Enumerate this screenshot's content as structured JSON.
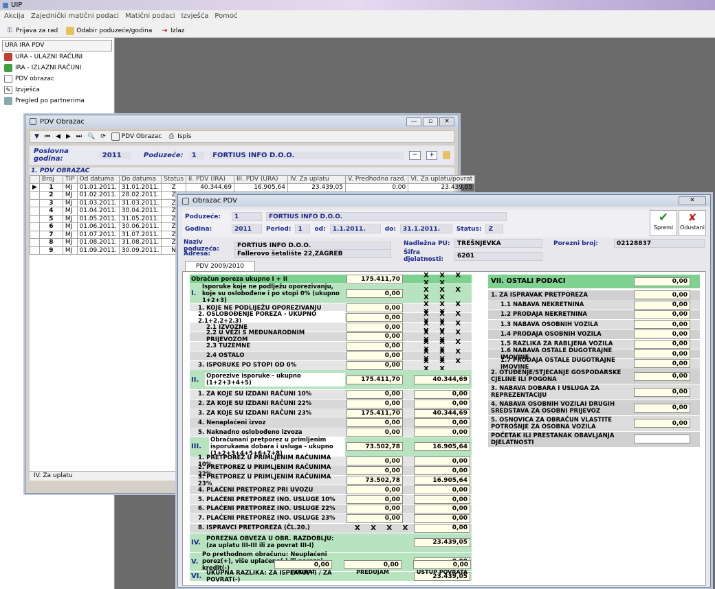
{
  "app": {
    "title": "UIP"
  },
  "menu": [
    "Akcija",
    "Zajednički matični podaci",
    "Matični podaci",
    "Izvješća",
    "Pomoć"
  ],
  "toolbar": {
    "login": "Prijava za rad",
    "select": "Odabir poduzeće/godina",
    "exit": "Izlaz"
  },
  "nav": {
    "header": "URA IRA PDV",
    "items": [
      "URA - ULAZNI RAČUNI",
      "IRA - IZLAZNI RAČUNI",
      "PDV obrazac",
      "Izvješća",
      "Pregled po partnerima"
    ]
  },
  "w1": {
    "title": "PDV Obrazac",
    "tb_pdv": "PDV Obrazac",
    "tb_print": "Ispis",
    "godina_lbl": "Poslovna godina:",
    "godina": "2011",
    "pod_lbl": "Poduzeće:",
    "pod_id": "1",
    "pod_name": "FORTIUS INFO D.O.O.",
    "grid_title": "1. PDV OBRAZAC",
    "cols": [
      "Broj",
      "TIP",
      "Od datuma",
      "Do datuma",
      "Status",
      "II. PDV (IRA)",
      "III. PDV (URA)",
      "IV. Za uplatu",
      "V. Predhodno razd.",
      "VI. Za uplatu/povrat"
    ],
    "rows": [
      [
        "1",
        "MJ",
        "01.01.2011.",
        "31.01.2011.",
        "Z",
        "40.344,69",
        "16.905,64",
        "23.439,05",
        "0,00",
        "23.439,05"
      ],
      [
        "2",
        "MJ",
        "01.02.2011.",
        "28.02.2011.",
        "Z"
      ],
      [
        "3",
        "MJ",
        "01.03.2011.",
        "31.03.2011.",
        "Z"
      ],
      [
        "4",
        "MJ",
        "01.04.2011.",
        "30.04.2011.",
        "Z"
      ],
      [
        "5",
        "MJ",
        "01.05.2011.",
        "31.05.2011.",
        "Z"
      ],
      [
        "6",
        "MJ",
        "01.06.2011.",
        "30.06.2011.",
        "Z"
      ],
      [
        "7",
        "MJ",
        "01.07.2011.",
        "31.07.2011.",
        "Z"
      ],
      [
        "8",
        "MJ",
        "01.08.2011.",
        "31.08.2011.",
        "Z"
      ],
      [
        "9",
        "MJ",
        "01.09.2011.",
        "30.09.2011.",
        "N"
      ]
    ],
    "status": "IV. Za uplatu"
  },
  "w2": {
    "title": "Obrazac PDV",
    "poduzece_lbl": "Poduzeće:",
    "pod_id": "1",
    "pod_name": "FORTIUS INFO D.O.O.",
    "godina_lbl": "Godina:",
    "godina": "2011",
    "period_lbl": "Period:",
    "period": "1",
    "od_lbl": "od:",
    "od": "1.1.2011.",
    "do_lbl": "do:",
    "do": "31.1.2011.",
    "status_lbl": "Status:",
    "status": "Z",
    "save": "Spremi",
    "cancel": "Odustani",
    "naziv_lbl": "Naziv poduzeća:",
    "naziv": "FORTIUS INFO D.O.O.",
    "adresa_lbl": "Adresa:",
    "adresa": "Fallerovo šetalište 22,ZAGREB",
    "pu_lbl": "Nadležna PU:",
    "pu": "TREŠNJEVKA",
    "sifra_lbl": "Šifra djelatnosti:",
    "sifra": "6201",
    "porezni_lbl": "Porezni broj:",
    "porezni": "02128837",
    "tab": "PDV 2009/2010",
    "left": [
      {
        "t": "Obračun poreza ukupno I + II",
        "a": "175.411,70",
        "b": "X X X X X",
        "c": "green"
      },
      {
        "r": "I.",
        "t": "Isporuke koje ne podlježu oporezivanju, koje su oslobođene i po stopi 0% (ukupno 1+2+3)",
        "a": "0,00",
        "b": "X X X X X",
        "c": "lgreen",
        "h": 2
      },
      {
        "t": "1. KOJE NE PODLIJEŽU OPOREZIVANJU",
        "a": "0,00",
        "b": "X X X X X",
        "i": 1
      },
      {
        "t": "2. OSLOBOĐENJE POREZA - UKUPNO 2.1+2.2+2.3)",
        "a": "0,00",
        "b": "X X X X X",
        "i": 1,
        "y": 1
      },
      {
        "t": "2.1 IZVOZNE",
        "a": "0,00",
        "b": "X X X X X",
        "i": 2
      },
      {
        "t": "2.2 U VEZI S MEĐUNARODNIM PRIJEVOZOM",
        "a": "0,00",
        "b": "X X X X X",
        "i": 2
      },
      {
        "t": "2.3 TUZEMNE",
        "a": "0,00",
        "b": "X X X X X",
        "i": 2
      },
      {
        "t": "2.4 OSTALO",
        "a": "0,00",
        "b": "X X X X X",
        "i": 2
      },
      {
        "t": "3. ISPORUKE PO STOPI OD 0%",
        "a": "0,00",
        "b": "X X X X X",
        "i": 1
      },
      {
        "r": "II.",
        "t": "Oporezive isporuke - ukupno (1+2+3+4+5)",
        "a": "175.411,70",
        "b2": "40.344,69",
        "c": "lgreen",
        "h": 2,
        "y": 1
      },
      {
        "t": "1. ZA KOJE SU IZDANI RAČUNI 10%",
        "a": "0,00",
        "b2": "0,00",
        "i": 1
      },
      {
        "t": "2. ZA KOJE SU IZDANI RAČUNI 22%",
        "a": "0,00",
        "b2": "0,00",
        "i": 1
      },
      {
        "t": "3. ZA KOJE SU IZDANI RAČUNI 23%",
        "a": "175.411,70",
        "b2": "40.344,69",
        "i": 1
      },
      {
        "t": "4. Nenaplaćeni izvoz",
        "a": "0,00",
        "b2": "0,00",
        "i": 1
      },
      {
        "t": "5. Naknadno oslobođeno izvoza",
        "a": "0,00",
        "b2": "0,00",
        "i": 1
      },
      {
        "r": "III.",
        "t": "Obračunani pretporez u primljenim isporukama dobara i usluga - ukupno (1+2+3+4+5+6+7+8)",
        "a": "73.502,78",
        "b2": "16.905,64",
        "c": "lgreen",
        "h": 2,
        "y": 1
      },
      {
        "t": "1. PRETPOREZ U PRIMLJENIM RAČUNIMA 10%",
        "a": "0,00",
        "b2": "0,00",
        "i": 1
      },
      {
        "t": "2. PRETPOREZ U PRIMLJENIM RAČUNIMA 22%",
        "a": "0,00",
        "b2": "0,00",
        "i": 1
      },
      {
        "t": "3. PRETPOREZ U PRIMLJENIM RAČUNIMA 23%",
        "a": "73.502,78",
        "b2": "16.905,64",
        "i": 1
      },
      {
        "t": "4. PLAĆENI PRETPOREZ PRI UVOZU",
        "a": "0,00",
        "b2": "0,00",
        "i": 1
      },
      {
        "t": "5. PLAĆENI PRETPOREZ INO. USLUGE 10%",
        "a": "0,00",
        "b2": "0,00",
        "i": 1
      },
      {
        "t": "6. PLAĆENI PRETPOREZ INO. USLUGE 22%",
        "a": "0,00",
        "b2": "0,00",
        "i": 1
      },
      {
        "t": "7. PLAĆENI PRETPOREZ INO. USLUGE 23%",
        "a": "0,00",
        "b2": "0,00",
        "i": 1
      },
      {
        "t": "8. ISPRAVCI PRETPOREZA (ČL.20.)",
        "ax": "X X X X X",
        "b2": "0,00",
        "i": 1
      },
      {
        "r": "IV.",
        "t": "POREZNA OBVEZA U OBR. RAZDOBLJU: (za uplatu III-III ili za povrat III-I)",
        "b2": "23.439,05",
        "c": "lgreen",
        "h": 2
      },
      {
        "r": "V.",
        "t": "Po prethodnom obračunu: Neuplaćeni porez(+), više uplaćeno(-) ili porezni  kredit(-)",
        "b2": "0,00",
        "c": "lgreen",
        "h": 2
      },
      {
        "r": "VI.",
        "t": "UKUPNA RAZLIKA: ZA ISPLATU(+) / ZA POVRAT(-)",
        "b2": "23.439,05",
        "c": "lgreen"
      }
    ],
    "bottom": [
      {
        "v": "0,00",
        "l": "POVRAT"
      },
      {
        "v": "0,00",
        "l": "PREDUJAM"
      },
      {
        "v": "0,00",
        "l": "USTUP POVRATA"
      }
    ],
    "right": [
      {
        "t": "VII. OSTALI PODACI",
        "v": "0,00",
        "c": "green",
        "big": 1
      },
      {
        "t": "1. ZA ISPRAVAK PRETPOREZA",
        "v": "0,00",
        "c": "grey"
      },
      {
        "t": "1.1 NABAVA NEKRETNINA",
        "v": "0,00",
        "i": 1
      },
      {
        "t": "1.2 PRODAJA NEKRETNINA",
        "v": "0,00",
        "i": 1
      },
      {
        "t": "1.3 NABAVA OSOBNIH VOZILA",
        "v": "0,00",
        "i": 1
      },
      {
        "t": "1.4 PRODAJA OSOBNIH VOZILA",
        "v": "0,00",
        "i": 1
      },
      {
        "t": "1.5 RAZLIKA ZA RABLJENA VOZILA",
        "v": "0,00",
        "i": 1
      },
      {
        "t": "1.6 NABAVA OSTALE DUGOTRAJNE IMOVINE",
        "v": "0,00",
        "i": 1
      },
      {
        "t": "1.7 PRODAJA OSTALE DUGOTRAJNE IMOVINE",
        "v": "0,00",
        "i": 1
      },
      {
        "t": "2. OTUĐENJE/STJECANJE GOSPODARSKE CJELINE ILI POGONA",
        "v": "0,00",
        "h": 2
      },
      {
        "t": "3. NABAVA DOBARA I USLUGA ZA REPREZENTACIJU",
        "v": "0,00",
        "h": 2
      },
      {
        "t": "4. NABAVA OSOBNIH VOZILAI DRUGIH SREDSTAVA ZA OSOBNI PRIJEVOZ",
        "v": "0,00",
        "h": 2
      },
      {
        "t": "5. OSNOVICA ZA OBRAČUN VLASTITE POTROŠNJE ZA OSOBNA VOZILA",
        "v": "0,00",
        "h": 2
      },
      {
        "t": "POČETAK ILI PRESTANAK OBAVLJANJA DJELATNOSTI",
        "v": "",
        "h": 2
      }
    ]
  }
}
